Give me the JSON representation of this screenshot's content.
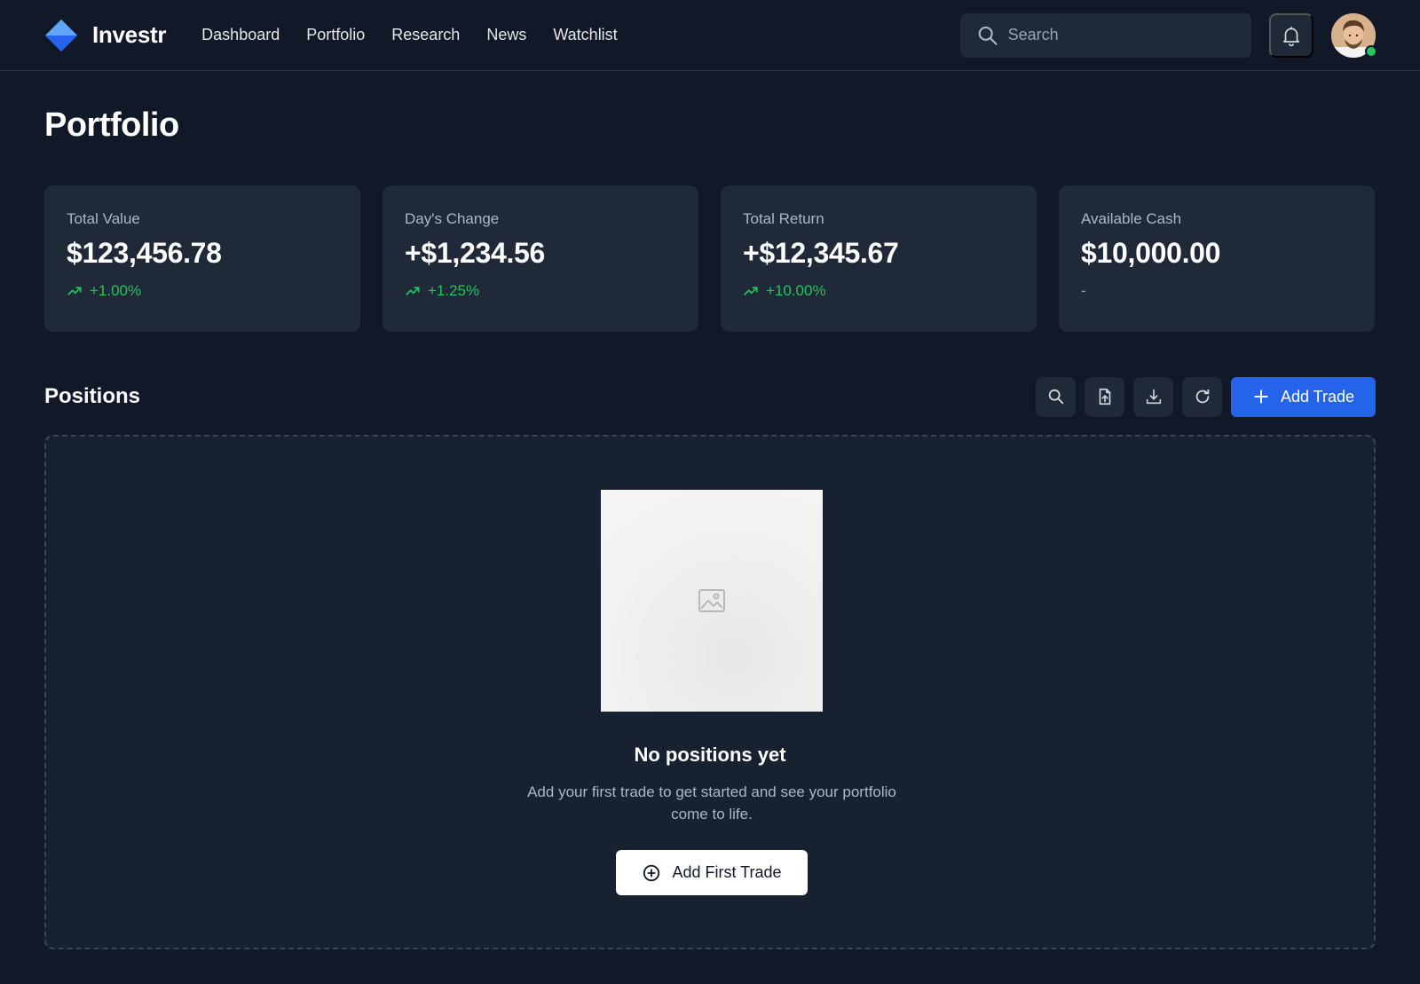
{
  "brand": {
    "name": "Investr",
    "logo_icon": "diamond-logo-icon",
    "accent": "#3b82f6"
  },
  "nav": {
    "items": [
      "Dashboard",
      "Portfolio",
      "Research",
      "News",
      "Watchlist"
    ]
  },
  "search": {
    "placeholder": "Search",
    "value": ""
  },
  "header": {
    "notifications_icon": "bell-icon",
    "avatar_status": "online"
  },
  "page": {
    "title": "Portfolio"
  },
  "stats": [
    {
      "label": "Total Value",
      "value": "$123,456.78",
      "change": "+1.00%",
      "trend": "up"
    },
    {
      "label": "Day's Change",
      "value": "+$1,234.56",
      "change": "+1.25%",
      "trend": "up"
    },
    {
      "label": "Total Return",
      "value": "+$12,345.67",
      "change": "+10.00%",
      "trend": "up"
    },
    {
      "label": "Available Cash",
      "value": "$10,000.00",
      "change": "-",
      "trend": "none"
    }
  ],
  "positions": {
    "title": "Positions",
    "tools": [
      "search-icon",
      "file-upload-icon",
      "download-icon",
      "refresh-icon"
    ],
    "add_trade_label": "Add Trade",
    "empty": {
      "title": "No positions yet",
      "description": "Add your first trade to get started and see your portfolio come to life.",
      "button_label": "Add First Trade"
    }
  },
  "colors": {
    "background": "#111827",
    "card": "#1f2937",
    "positive": "#22c55e",
    "primary_button": "#2563eb"
  }
}
